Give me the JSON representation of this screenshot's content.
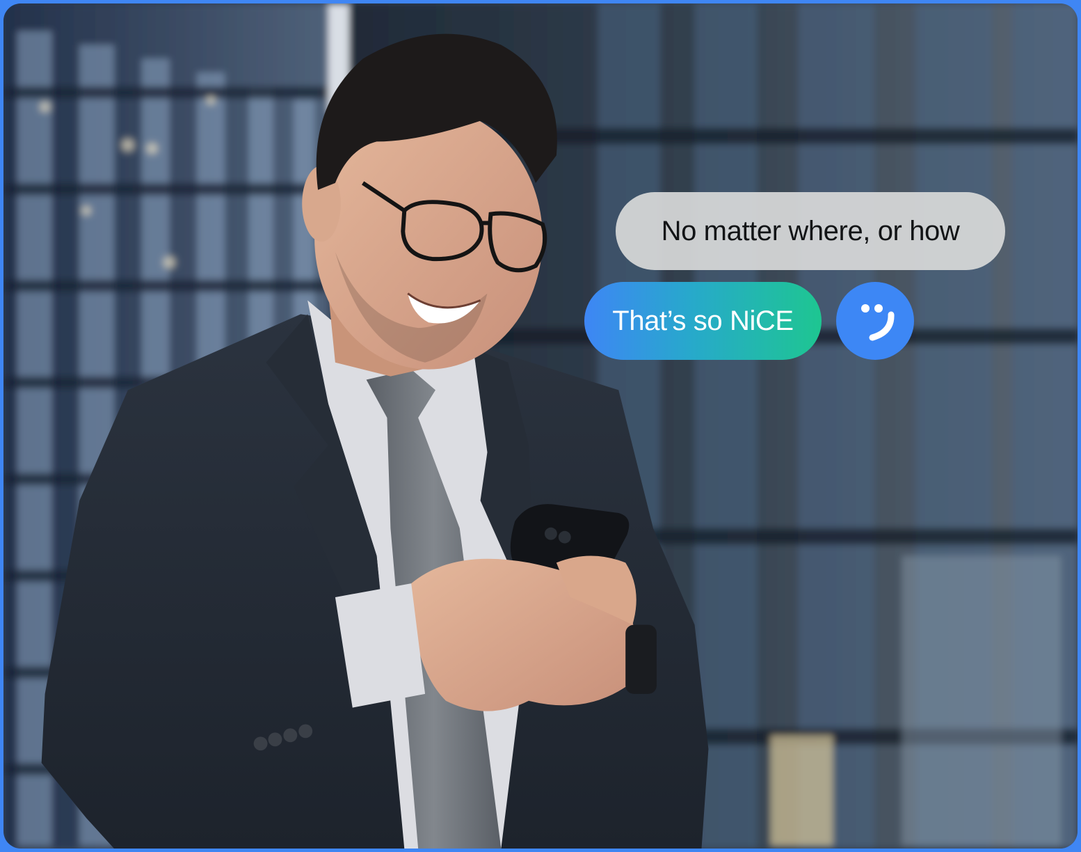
{
  "photo": {
    "subject": "smiling businessman in glasses and suit using smartphone outdoors",
    "background": "blurred glass office buildings"
  },
  "chat": {
    "incoming_text": "No matter where, or how",
    "outgoing_text": "That’s so NiCE"
  },
  "icons": {
    "avatar": "smiley-face-icon"
  },
  "colors": {
    "border": "#3f86f4",
    "bubble_grey": "#d7d8d8",
    "gradient_start": "#3e86f5",
    "gradient_mid": "#27a9cb",
    "gradient_end": "#1ec691",
    "avatar_bg": "#3d87f5"
  }
}
